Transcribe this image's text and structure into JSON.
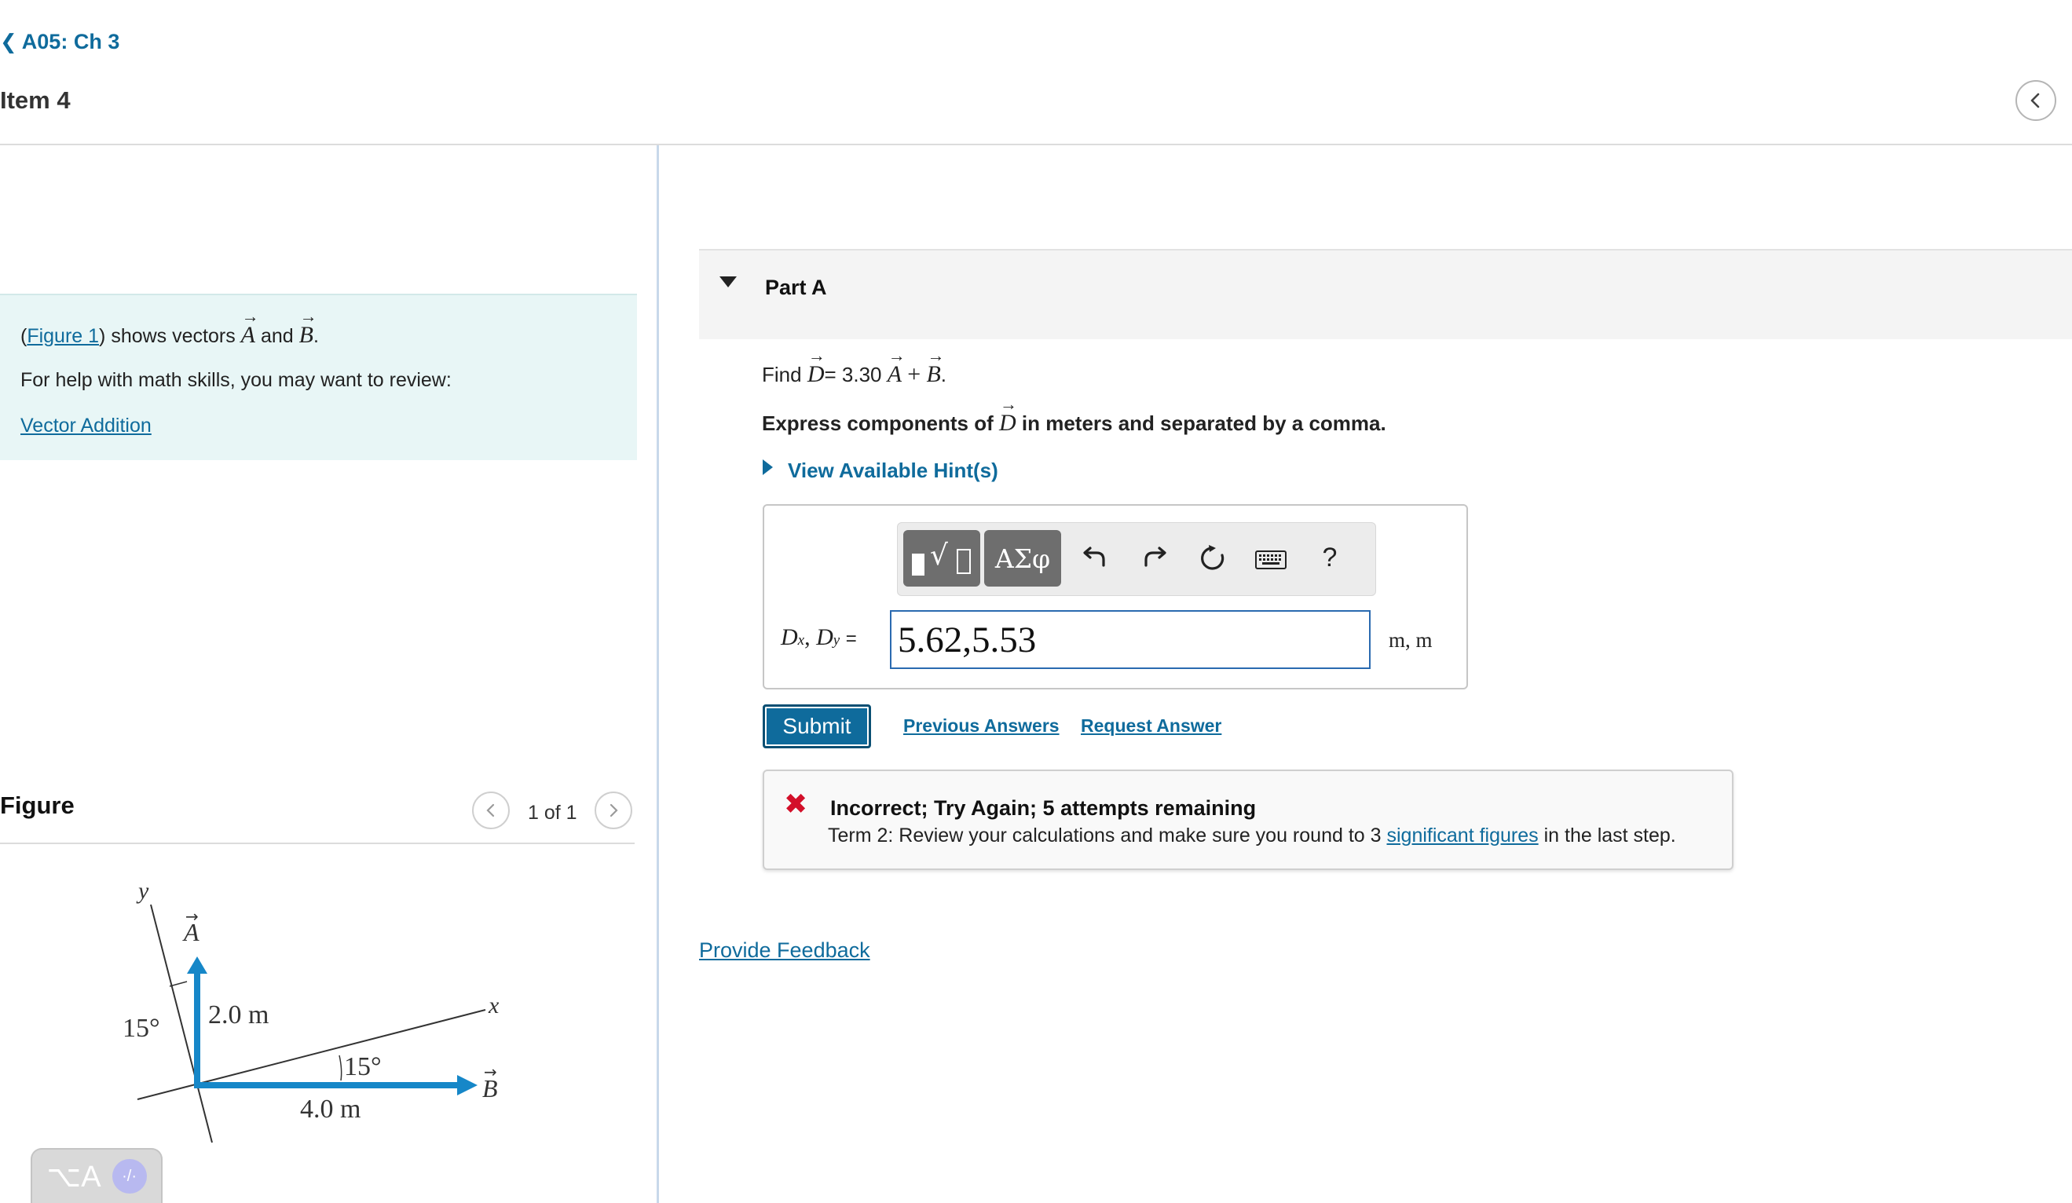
{
  "header": {
    "back_label": "A05: Ch 3",
    "item_title": "Item 4"
  },
  "intro": {
    "figure_link": "Figure 1",
    "shows_text": ") shows vectors",
    "vector_a": "A",
    "and_text": "and",
    "vector_b": "B",
    "help_text": "For help with math skills, you may want to review:",
    "review_link": "Vector Addition"
  },
  "figure": {
    "title": "Figure",
    "counter": "1 of 1",
    "labels": {
      "y_axis": "y",
      "x_axis": "x",
      "vector_a": "A",
      "vector_b": "B",
      "a_length": "2.0 m",
      "b_length": "4.0 m",
      "angle_left": "15°",
      "angle_right": "15°"
    }
  },
  "part": {
    "title": "Part A",
    "find_prefix": "Find",
    "vector_d": "D",
    "equation_rhs": "= 3.30",
    "plus": "+",
    "express_prefix": "Express components of",
    "express_suffix": "in meters and separated by a comma.",
    "hints_label": "View Available Hint(s)"
  },
  "answer": {
    "toolbar": {
      "greek_label": "ΑΣφ",
      "help_label": "?"
    },
    "label_d": "D",
    "label_x": "x",
    "label_y": "y",
    "equals": "=",
    "value": "5.62,5.53",
    "units": "m, m"
  },
  "actions": {
    "submit_label": "Submit",
    "previous_answers": "Previous Answers",
    "request_answer": "Request Answer"
  },
  "feedback": {
    "title": "Incorrect; Try Again; 5 attempts remaining",
    "message_prefix": "Term 2: Review your calculations and make sure you round to 3",
    "message_link": "significant figures",
    "message_suffix": "in the last step."
  },
  "footer": {
    "provide_feedback": "Provide Feedback",
    "kbd_hint": "⌥A"
  },
  "colors": {
    "link": "#0f6b9c",
    "vector_blue": "#1687c8",
    "error_red": "#d3102a",
    "intro_bg": "#e8f6f6"
  }
}
